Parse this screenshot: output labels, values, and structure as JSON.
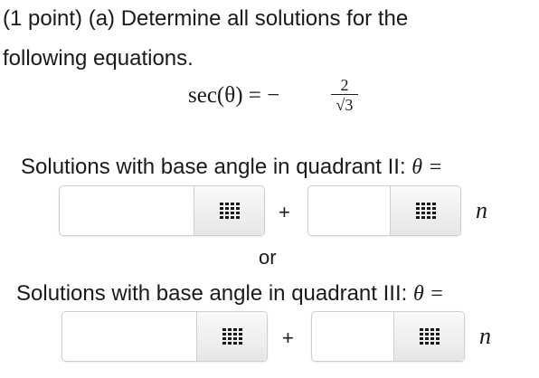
{
  "question": {
    "line1": "(1 point) (a) Determine all solutions for the",
    "line2": "following equations."
  },
  "equation": {
    "lhs": "sec(θ) = −",
    "numerator": "2",
    "denominator": "√3"
  },
  "quadrant2": {
    "label": "Solutions with base angle in quadrant II:",
    "theta_eq": "θ =",
    "base_angle_value": "",
    "period_value": "",
    "plus": "+",
    "n_var": "n"
  },
  "separator": {
    "or": "or"
  },
  "quadrant3": {
    "label": "Solutions with base angle in quadrant III:",
    "theta_eq": "θ =",
    "base_angle_value": "",
    "period_value": "",
    "plus": "+",
    "n_var": "n"
  },
  "icons": {
    "keyboard": "keypad-grid-icon"
  }
}
